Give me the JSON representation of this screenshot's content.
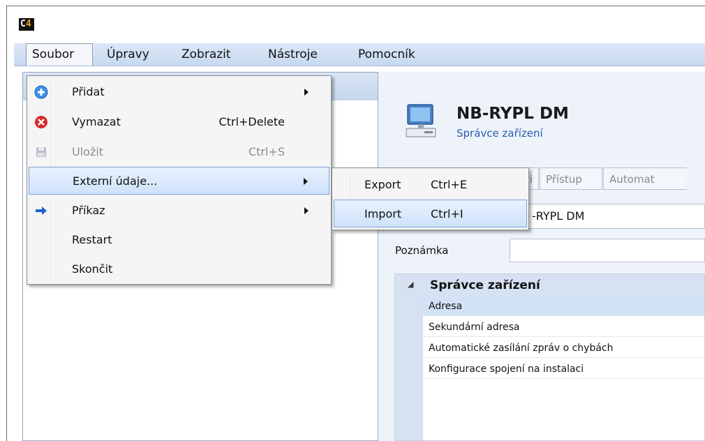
{
  "app": {
    "logo_text": "C",
    "logo_digit": "4"
  },
  "menubar": {
    "items": [
      {
        "label": "Soubor"
      },
      {
        "label": "Úpravy"
      },
      {
        "label": "Zobrazit"
      },
      {
        "label": "Nástroje"
      },
      {
        "label": "Pomocník"
      }
    ]
  },
  "file_menu": {
    "items": [
      {
        "label": "Přidat",
        "shortcut": "",
        "icon": "plus-circle-icon"
      },
      {
        "label": "Vymazat",
        "shortcut": "Ctrl+Delete",
        "icon": "red-x-circle-icon"
      },
      {
        "label": "Uložit",
        "shortcut": "Ctrl+S",
        "icon": "save-disk-icon"
      },
      {
        "label": "Externí údaje...",
        "shortcut": ""
      },
      {
        "label": "Příkaz",
        "shortcut": "",
        "icon": "blue-arrow-icon"
      },
      {
        "label": "Restart",
        "shortcut": ""
      },
      {
        "label": "Skončit",
        "shortcut": ""
      }
    ]
  },
  "external_submenu": {
    "items": [
      {
        "label": "Export",
        "shortcut": "Ctrl+E"
      },
      {
        "label": "Import",
        "shortcut": "Ctrl+I"
      }
    ]
  },
  "device": {
    "name": "NB-RYPL DM",
    "subtitle": "Správce zařízení",
    "icon": "computer-icon"
  },
  "tabs": [
    {
      "label": "osti"
    },
    {
      "label": "Přístup"
    },
    {
      "label": "Automat"
    }
  ],
  "name_field": {
    "value": "-RYPL DM"
  },
  "note": {
    "label": "Poznámka",
    "value": ""
  },
  "properties": {
    "category": "Správce zařízení",
    "rows": [
      {
        "label": "Adresa"
      },
      {
        "label": "Sekundární adresa"
      },
      {
        "label": "Automatické zasílání zpráv o chybách"
      },
      {
        "label": "Konfigurace spojení na instalaci"
      }
    ]
  },
  "colors": {
    "menubar": "#c7d8ef",
    "highlight": "#cfe2fb",
    "link_blue": "#2a5db0"
  }
}
